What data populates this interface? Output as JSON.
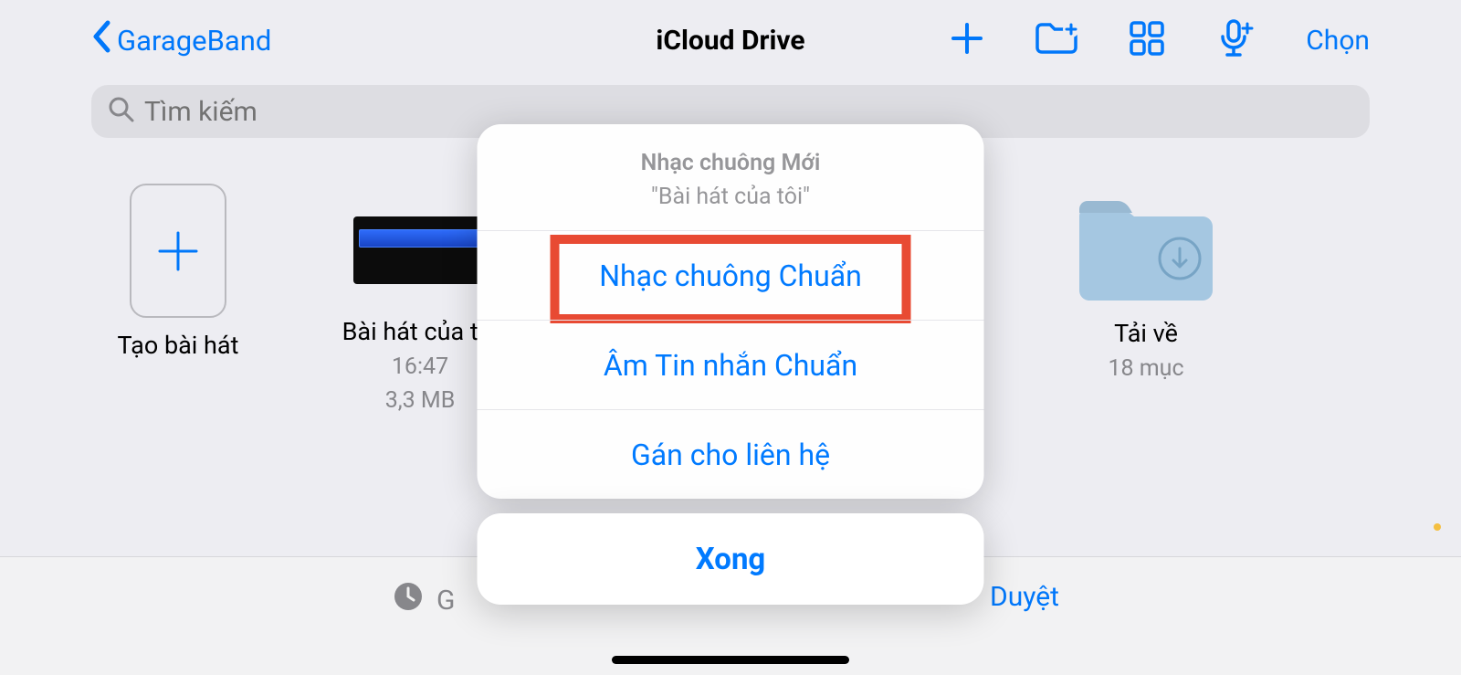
{
  "nav": {
    "back_label": "GarageBand",
    "title": "iCloud Drive",
    "select_label": "Chọn"
  },
  "search": {
    "placeholder": "Tìm kiếm"
  },
  "items": {
    "create": {
      "label": "Tạo bài hát"
    },
    "song": {
      "label": "Bài hát của tôi",
      "time": "16:47",
      "size": "3,3 MB"
    },
    "downloads": {
      "label": "Tải về",
      "count": "18 mục"
    }
  },
  "bottom": {
    "left_truncated": "G",
    "browse_label": "Duyệt"
  },
  "sheet": {
    "title": "Nhạc chuông Mới",
    "subtitle": "\"Bài hát của tôi\"",
    "opt_ringtone": "Nhạc chuông Chuẩn",
    "opt_texttone": "Âm Tin nhắn Chuẩn",
    "opt_contact": "Gán cho liên hệ",
    "done": "Xong"
  }
}
